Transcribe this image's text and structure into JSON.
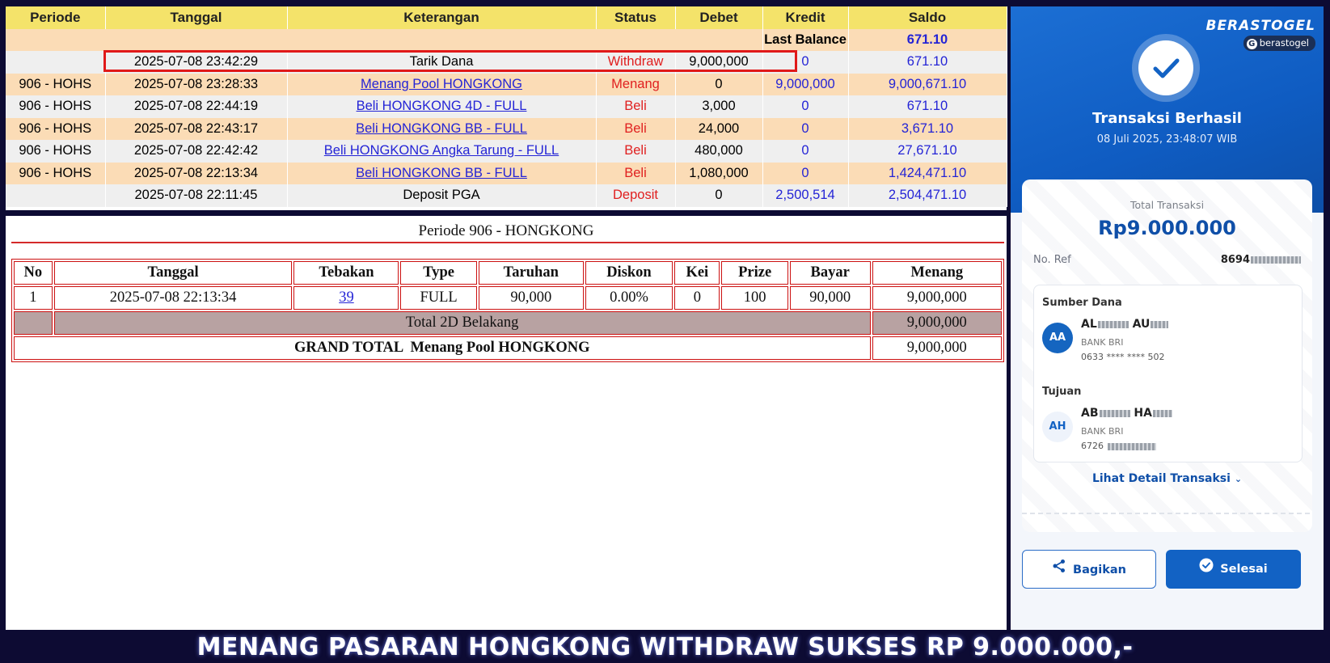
{
  "ledger": {
    "headers": [
      "Periode",
      "Tanggal",
      "Keterangan",
      "Status",
      "Debet",
      "Kredit",
      "Saldo"
    ],
    "last_balance_label": "Last Balance",
    "last_balance_value": "671.10",
    "rows": [
      {
        "periode": "",
        "tanggal": "2025-07-08 23:42:29",
        "keterangan": "Tarik Dana",
        "status": "Withdraw",
        "debet": "9,000,000",
        "kredit": "0",
        "saldo": "671.10"
      },
      {
        "periode": "906 - HOHS",
        "tanggal": "2025-07-08 23:28:33",
        "keterangan": "Menang Pool HONGKONG",
        "status": "Menang",
        "debet": "0",
        "kredit": "9,000,000",
        "saldo": "9,000,671.10"
      },
      {
        "periode": "906 - HOHS",
        "tanggal": "2025-07-08 22:44:19",
        "keterangan": "Beli HONGKONG 4D - FULL",
        "status": "Beli",
        "debet": "3,000",
        "kredit": "0",
        "saldo": "671.10"
      },
      {
        "periode": "906 - HOHS",
        "tanggal": "2025-07-08 22:43:17",
        "keterangan": "Beli HONGKONG BB - FULL",
        "status": "Beli",
        "debet": "24,000",
        "kredit": "0",
        "saldo": "3,671.10"
      },
      {
        "periode": "906 - HOHS",
        "tanggal": "2025-07-08 22:42:42",
        "keterangan": "Beli HONGKONG Angka Tarung - FULL",
        "status": "Beli",
        "debet": "480,000",
        "kredit": "0",
        "saldo": "27,671.10"
      },
      {
        "periode": "906 - HOHS",
        "tanggal": "2025-07-08 22:13:34",
        "keterangan": "Beli HONGKONG BB - FULL",
        "status": "Beli",
        "debet": "1,080,000",
        "kredit": "0",
        "saldo": "1,424,471.10"
      },
      {
        "periode": "",
        "tanggal": "2025-07-08 22:11:45",
        "keterangan": "Deposit PGA",
        "status": "Deposit",
        "debet": "0",
        "kredit": "2,500,514",
        "saldo": "2,504,471.10"
      }
    ]
  },
  "detail": {
    "title": "Periode 906 - HONGKONG",
    "headers": [
      "No",
      "Tanggal",
      "Tebakan",
      "Type",
      "Taruhan",
      "Diskon",
      "Kei",
      "Prize",
      "Bayar",
      "Menang"
    ],
    "row": {
      "no": "1",
      "tanggal": "2025-07-08 22:13:34",
      "tebakan": "39",
      "type": "FULL",
      "taruhan": "90,000",
      "diskon": "0.00%",
      "kei": "0",
      "prize": "100",
      "bayar": "90,000",
      "menang": "9,000,000"
    },
    "total_label": "Total 2D Belakang",
    "total_value": "9,000,000",
    "grand_label": "GRAND TOTAL  Menang Pool HONGKONG",
    "grand_value": "9,000,000"
  },
  "receipt": {
    "brand": "BERASTOGEL",
    "brand_tag": "berastogel",
    "status_title": "Transaksi Berhasil",
    "datetime": "08 Juli 2025, 23:48:07 WIB",
    "total_label": "Total Transaksi",
    "total_amount": "Rp9.000.000",
    "ref_label": "No. Ref",
    "ref_value": "8694",
    "source_label": "Sumber Dana",
    "source_initials": "AA",
    "source_name_a": "AL",
    "source_name_b": "AU",
    "source_bank": "BANK BRI",
    "source_account": "0633 **** **** 502",
    "dest_label": "Tujuan",
    "dest_initials": "AH",
    "dest_name_a": "AB",
    "dest_name_b": "HA",
    "dest_bank": "BANK BRI",
    "dest_account": "6726",
    "detail_link": "Lihat Detail Transaksi",
    "share_label": "Bagikan",
    "done_label": "Selesai",
    "colors": {
      "primary": "#1262c4",
      "source_avatar": "#1565c0",
      "dest_avatar": "#eef3fb"
    }
  },
  "caption": "MENANG PASARAN HONGKONG WITHDRAW SUKSES RP 9.000.000,-"
}
